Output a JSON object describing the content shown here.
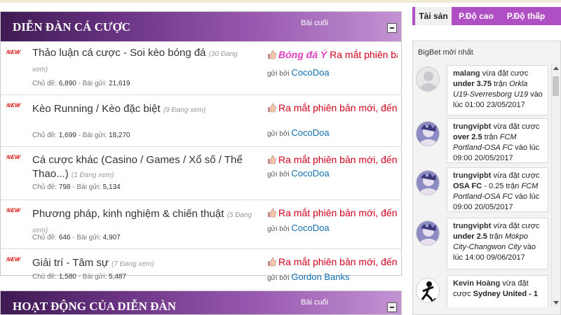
{
  "forum": {
    "title": "DIỄN ĐÀN CÁ CƯỢC",
    "last_col_label": "Bài cuối",
    "rows": [
      {
        "title": "Thảo luận cá cược - Soi kèo bóng đá",
        "viewing": "(30 Đang xem)",
        "meta_threads_label": "Chủ đề:",
        "threads": "6,890",
        "meta_posts_label": "Bài gửi:",
        "posts": "21,619",
        "last_category": "Bóng đá Ý",
        "last_title": "Ra mắt phiên bản mới",
        "last_by": "gửi bởi",
        "last_user": "CocoDoa"
      },
      {
        "title": "Kèo Running / Kèo đặc biệt",
        "viewing": "(9 Đang xem)",
        "meta_threads_label": "Chủ đề:",
        "threads": "1,699",
        "meta_posts_label": "Bài gửi:",
        "posts": "18,270",
        "last_category": "",
        "last_title": "Ra mắt phiên bản mới, đến...",
        "last_by": "gửi bởi",
        "last_user": "CocoDoa"
      },
      {
        "title": "Cá cược khác (Casino / Games / Xổ số / Thể Thao...)",
        "viewing": "(1 Đang xem)",
        "meta_threads_label": "Chủ đề:",
        "threads": "798",
        "meta_posts_label": "Bài gửi:",
        "posts": "5,134",
        "last_category": "",
        "last_title": "Ra mắt phiên bản mới, đến...",
        "last_by": "gửi bởi",
        "last_user": "CocoDoa"
      },
      {
        "title": "Phương pháp, kinh nghiệm & chiến thuật",
        "viewing": "(5 Đang xem)",
        "meta_threads_label": "Chủ đề:",
        "threads": "646",
        "meta_posts_label": "Bài gửi:",
        "posts": "4,907",
        "last_category": "",
        "last_title": "Ra mắt phiên bản mới, đến...",
        "last_by": "gửi bởi",
        "last_user": "CocoDoa"
      },
      {
        "title": "Giải trí - Tâm sự",
        "viewing": "(7 Đang xem)",
        "meta_threads_label": "Chủ đề:",
        "threads": "1,580",
        "meta_posts_label": "Bài gửi:",
        "posts": "5,487",
        "last_category": "",
        "last_title": "Ra mắt phiên bản mới, đến...",
        "last_by": "gửi bởi",
        "last_user": "Gordon Banks"
      }
    ],
    "new_badge": "NEW"
  },
  "forum2": {
    "title": "HOẠT ĐỘNG CỦA DIỄN ĐÀN",
    "last_col_label": "Bài cuối"
  },
  "sidebar": {
    "tabs": [
      "Tài sản",
      "P.Độ cao",
      "P.Độ thấp"
    ],
    "title": "BigBet mới nhất",
    "bets": [
      {
        "name": "malang",
        "verb": "vừa đặt cược",
        "pick": "under 3.75",
        "match_pre": "trận",
        "match": "Orkla U19-Sverresborg U19",
        "time": "vào lúc 01:00 23/05/2017"
      },
      {
        "name": "trungvipbt",
        "verb": "vừa đặt cược",
        "pick": "over 2.5",
        "match_pre": "trận",
        "match": "FCM Portland-OSA FC",
        "time": "vào lúc 09:00 20/05/2017"
      },
      {
        "name": "trungvipbt",
        "verb": "vừa đặt cược",
        "pick": "OSA FC",
        "odds": "- 0.25",
        "match_pre": "trận",
        "match": "FCM Portland-OSA FC",
        "time": "vào lúc 09:00 20/05/2017"
      },
      {
        "name": "trungvipbt",
        "verb": "vừa đặt cược",
        "pick": "under 2.5",
        "match_pre": "trận",
        "match": "Mokpo City-Changwon City",
        "time": "vào lúc 14:00 09/06/2017"
      },
      {
        "name": "Kevin Hoàng",
        "verb": "vừa đặt cược",
        "pick": "Sydney United - 1",
        "match_pre": "",
        "match": "",
        "time": ""
      }
    ]
  }
}
